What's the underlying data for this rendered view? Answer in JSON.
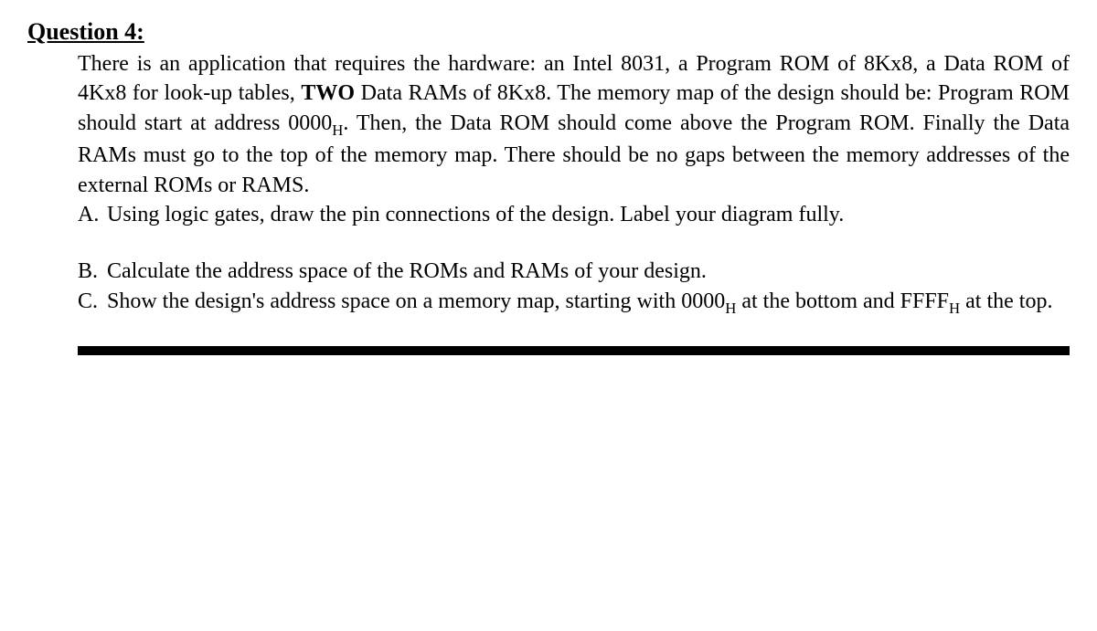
{
  "title": "Question 4:",
  "intro": {
    "part1": "There is an application that requires the hardware: an Intel 8031, a Program ROM of 8Kx8, a Data ROM of 4Kx8 for look-up tables, ",
    "bold": "TWO",
    "part2": " Data RAMs of 8Kx8. The memory map of the design should be: Program ROM should start at address 0000",
    "sub1": "H",
    "part3": ". Then, the Data ROM should come above the Program ROM. Finally the Data RAMs must go to the top of the memory map. There should be no gaps between the memory addresses of the external ROMs or RAMS."
  },
  "items": {
    "a": {
      "letter": "A.",
      "text": "Using logic gates, draw the pin connections of the design. Label your diagram fully."
    },
    "b": {
      "letter": "B.",
      "text": "Calculate the address space of the ROMs and RAMs of your design."
    },
    "c": {
      "letter": "C.",
      "part1": "Show the design's address space on a memory map, starting with 0000",
      "sub1": "H",
      "part2": " at the bottom and FFFF",
      "sub2": "H",
      "part3": " at the top."
    }
  }
}
